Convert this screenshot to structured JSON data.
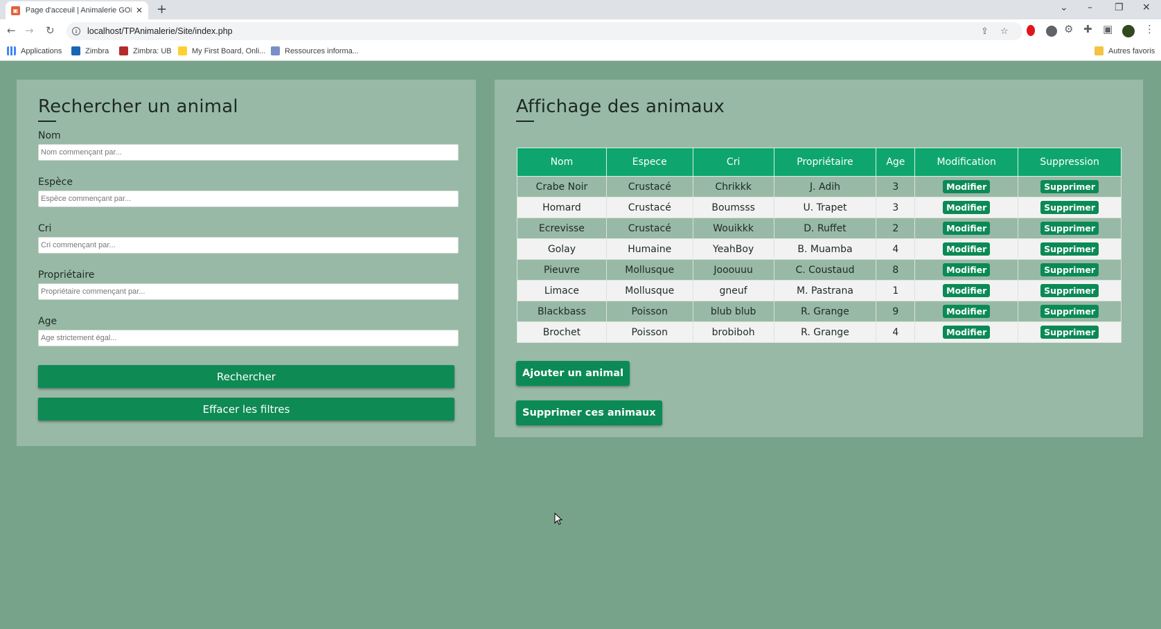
{
  "browser": {
    "tab_title": "Page d'acceuil | Animalerie GOLA",
    "url": "localhost/TPAnimalerie/Site/index.php",
    "bookmarks": [
      "Applications",
      "Zimbra",
      "Zimbra: UB",
      "My First Board, Onli...",
      "Ressources informa..."
    ],
    "other_favorites": "Autres favoris"
  },
  "search": {
    "title": "Rechercher un animal",
    "fields": [
      {
        "label": "Nom",
        "placeholder": "Nom commençant par..."
      },
      {
        "label": "Espèce",
        "placeholder": "Espèce commençant par..."
      },
      {
        "label": "Cri",
        "placeholder": "Cri commençant par..."
      },
      {
        "label": "Propriétaire",
        "placeholder": "Propriétaire commençant par..."
      },
      {
        "label": "Age",
        "placeholder": "Age strictement égal..."
      }
    ],
    "search_button": "Rechercher",
    "clear_button": "Effacer les filtres"
  },
  "display": {
    "title": "Affichage des animaux",
    "headers": [
      "Nom",
      "Espece",
      "Cri",
      "Propriétaire",
      "Age",
      "Modification",
      "Suppression"
    ],
    "rows": [
      [
        "Crabe Noir",
        "Crustacé",
        "Chrikkk",
        "J. Adih",
        "3"
      ],
      [
        "Homard",
        "Crustacé",
        "Boumsss",
        "U. Trapet",
        "3"
      ],
      [
        "Ecrevisse",
        "Crustacé",
        "Wouikkk",
        "D. Ruffet",
        "2"
      ],
      [
        "Golay",
        "Humaine",
        "YeahBoy",
        "B. Muamba",
        "4"
      ],
      [
        "Pieuvre",
        "Mollusque",
        "Jooouuu",
        "C. Coustaud",
        "8"
      ],
      [
        "Limace",
        "Mollusque",
        "gneuf",
        "M. Pastrana",
        "1"
      ],
      [
        "Blackbass",
        "Poisson",
        "blub blub",
        "R. Grange",
        "9"
      ],
      [
        "Brochet",
        "Poisson",
        "brobiboh",
        "R. Grange",
        "4"
      ]
    ],
    "modify_label": "Modifier",
    "delete_label": "Supprimer",
    "add_button": "Ajouter un animal",
    "delete_all_button": "Supprimer ces animaux"
  }
}
